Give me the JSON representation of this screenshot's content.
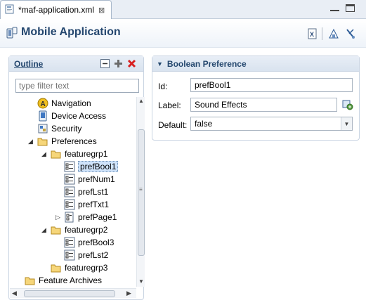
{
  "editor_tab": {
    "label": "*maf-application.xml",
    "close": "⊠"
  },
  "header": {
    "title": "Mobile Application"
  },
  "outline": {
    "title": "Outline",
    "filter_placeholder": "type filter text",
    "tree": [
      {
        "label": "Navigation"
      },
      {
        "label": "Device Access"
      },
      {
        "label": "Security"
      },
      {
        "label": "Preferences"
      },
      {
        "label": "featuregrp1"
      },
      {
        "label": "prefBool1"
      },
      {
        "label": "prefNum1"
      },
      {
        "label": "prefLst1"
      },
      {
        "label": "prefTxt1"
      },
      {
        "label": "prefPage1"
      },
      {
        "label": "featuregrp2"
      },
      {
        "label": "prefBool3"
      },
      {
        "label": "prefLst2"
      },
      {
        "label": "featuregrp3"
      },
      {
        "label": "Feature Archives"
      }
    ]
  },
  "boolean_preference": {
    "title": "Boolean Preference",
    "id_label": "Id:",
    "id_value": "prefBool1",
    "label_label": "Label:",
    "label_value": "Sound Effects",
    "default_label": "Default:",
    "default_value": "false"
  },
  "colors": {
    "section_title": "#24476e",
    "selection": "#cfe3fa",
    "delete_icon": "#d82020",
    "add_icon": "#6a6a6a"
  },
  "icons": {
    "tab": "xml-file-icon",
    "header": "mobile-app-icon",
    "delete": "red-x-icon",
    "add": "plus-icon",
    "collapse": "collapse-all-icon"
  }
}
